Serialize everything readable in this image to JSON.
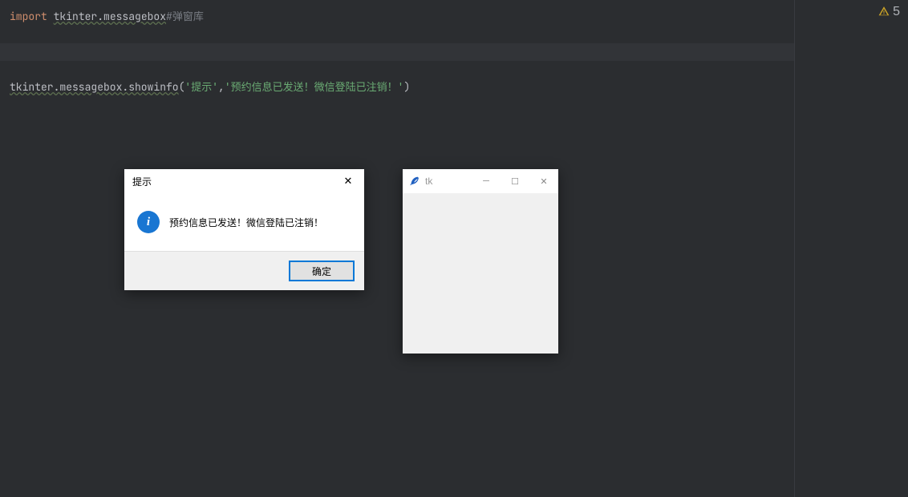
{
  "editor": {
    "line1": {
      "kw": "import",
      "mod": "tkinter.messagebox",
      "comment": "#弹窗库"
    },
    "line4": {
      "call": "tkinter.messagebox.showinfo",
      "open": "(",
      "arg1": "'提示'",
      "comma": ",",
      "arg2": "'预约信息已发送！微信登陆已注销！'",
      "close": ")"
    }
  },
  "warning": {
    "count": "5"
  },
  "dialog1": {
    "title": "提示",
    "message": "预约信息已发送！微信登陆已注销！",
    "ok": "确定",
    "close": "✕"
  },
  "dialog2": {
    "title": "tk",
    "min": "─",
    "max": "☐",
    "close": "✕"
  }
}
